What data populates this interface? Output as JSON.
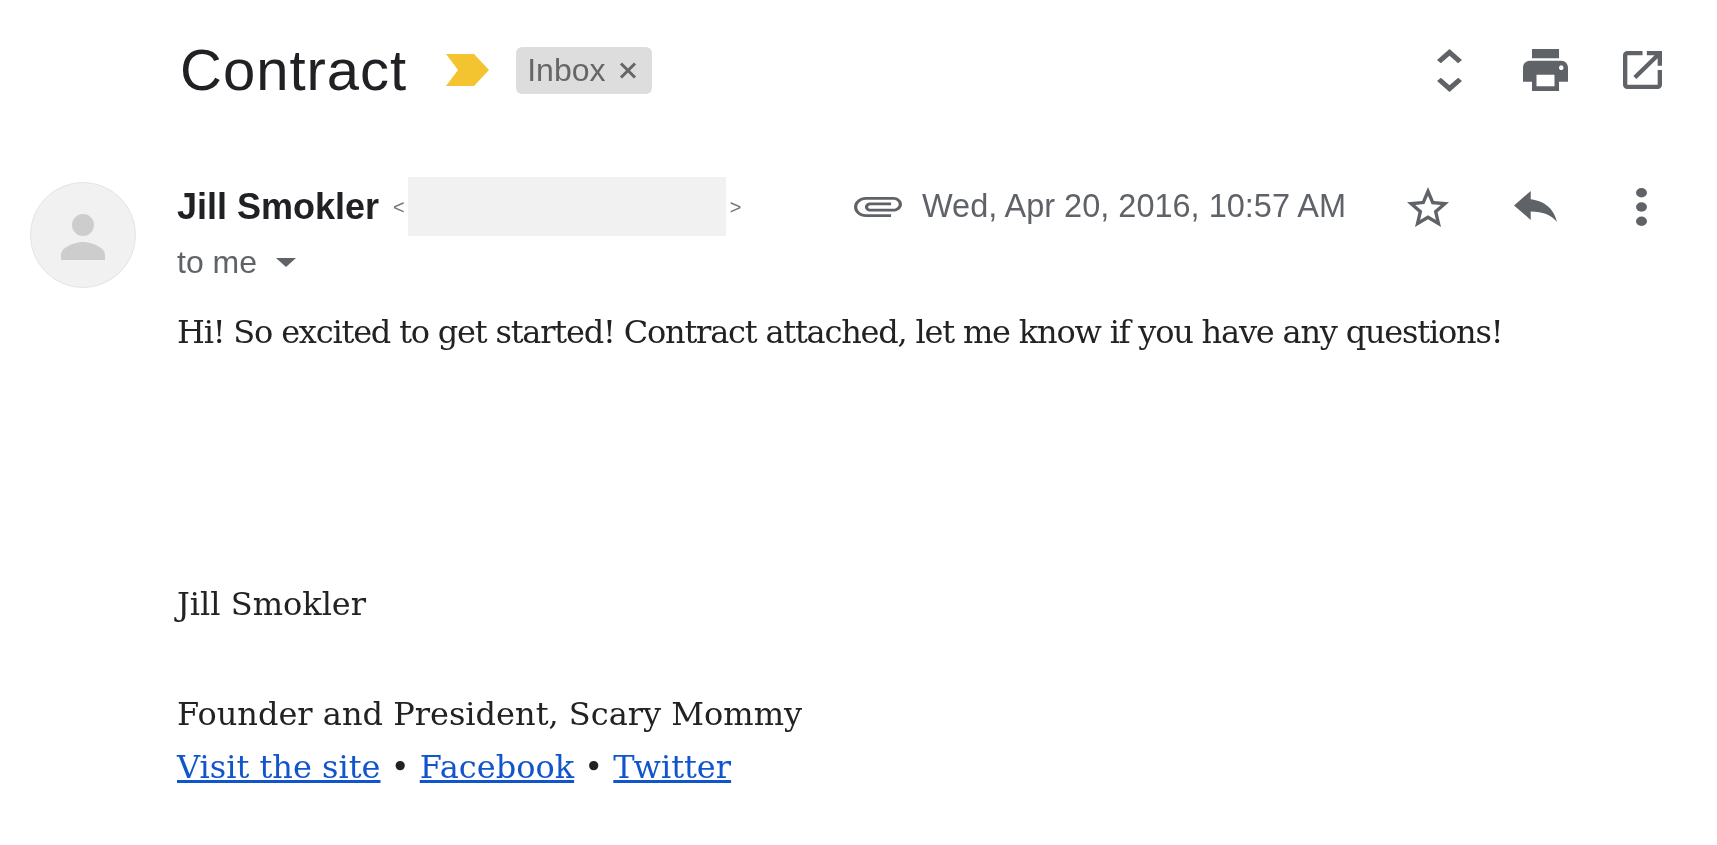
{
  "subject": {
    "title": "Contract",
    "important": true,
    "labels": [
      {
        "text": "Inbox"
      }
    ]
  },
  "message": {
    "sender": {
      "name": "Jill Smokler",
      "address_open": "<",
      "address_close": ">",
      "address_redacted": true
    },
    "recipient": "to me",
    "has_attachment": true,
    "date": "Wed, Apr 20, 2016, 10:57 AM",
    "starred": false,
    "body": [
      "Hi! So excited to get started! Contract attached, let me know if you have any questions!"
    ],
    "signature": {
      "name": "Jill Smokler",
      "title": "Founder and President, Scary Mommy",
      "links": [
        {
          "kind": "link",
          "text": "Visit the site"
        },
        {
          "kind": "separator",
          "text": "•"
        },
        {
          "kind": "link",
          "text": "Facebook"
        },
        {
          "kind": "separator",
          "text": "•"
        },
        {
          "kind": "link",
          "text": "Twitter"
        }
      ]
    }
  }
}
